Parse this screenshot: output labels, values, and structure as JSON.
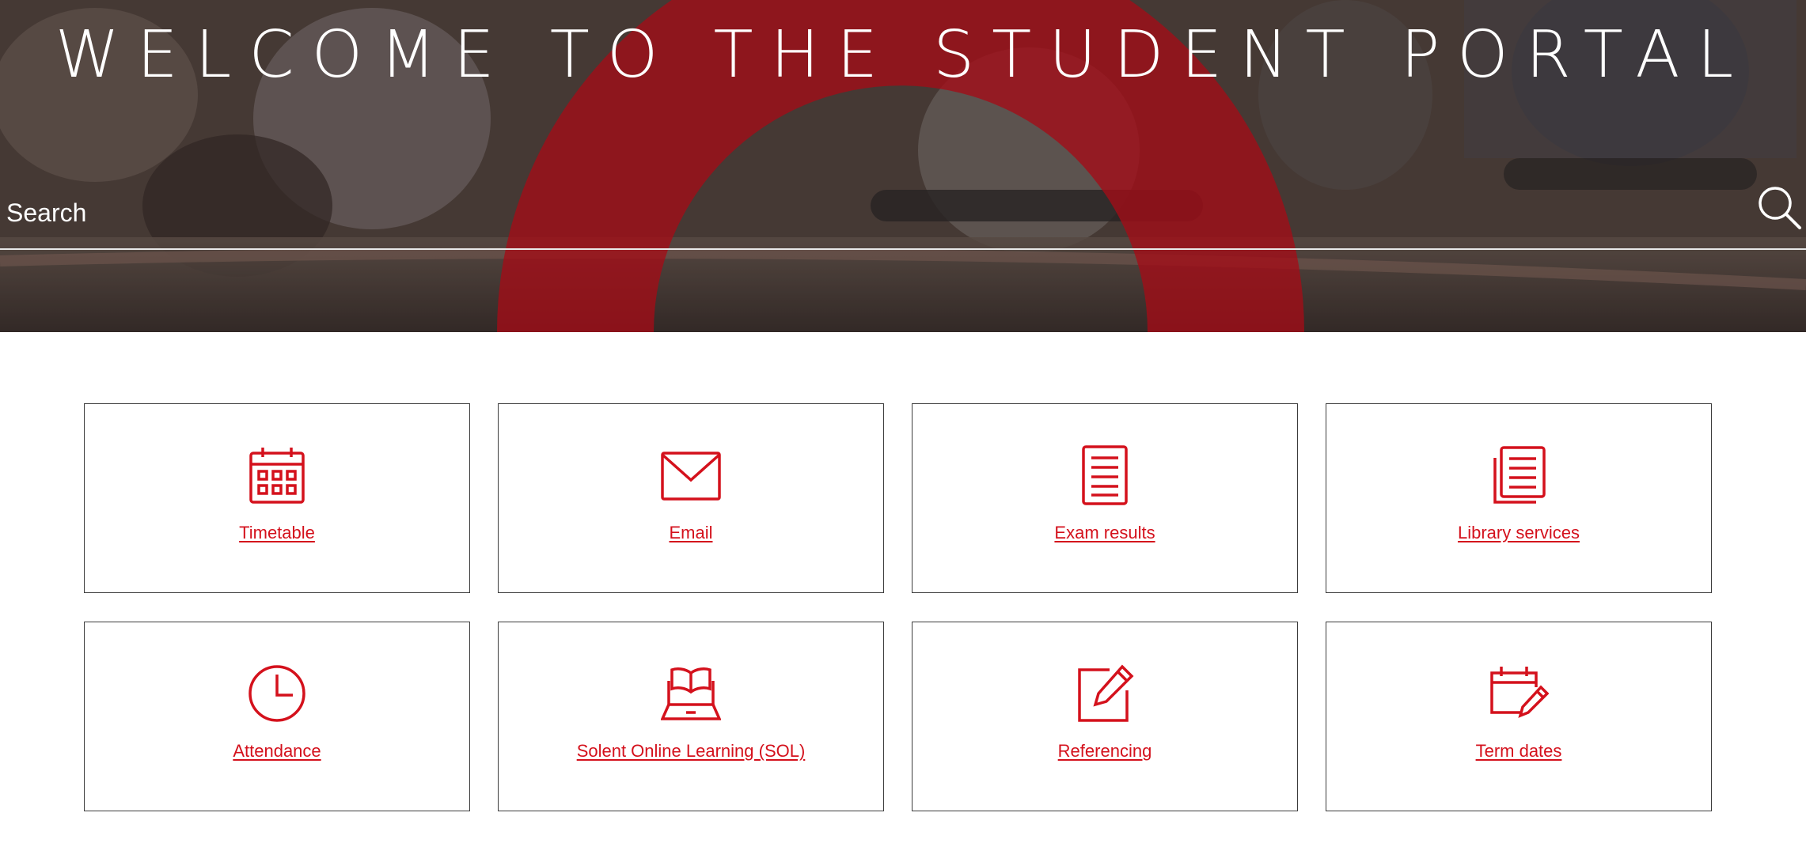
{
  "hero": {
    "title": "WELCOME TO THE STUDENT PORTAL",
    "search_placeholder": "Search",
    "search_icon": "search-icon"
  },
  "colors": {
    "accent": "#d4111c",
    "tile_border": "#3c3c3c",
    "hero_overlay_red": "#c8101c"
  },
  "tiles": [
    {
      "label": "Timetable",
      "icon": "calendar-icon"
    },
    {
      "label": "Email",
      "icon": "envelope-icon"
    },
    {
      "label": "Exam results",
      "icon": "document-icon"
    },
    {
      "label": "Library services",
      "icon": "documents-stack-icon"
    },
    {
      "label": "Attendance",
      "icon": "clock-icon"
    },
    {
      "label": "Solent Online Learning (SOL)",
      "icon": "laptop-book-icon"
    },
    {
      "label": "Referencing",
      "icon": "edit-pencil-icon"
    },
    {
      "label": "Term dates",
      "icon": "calendar-edit-icon"
    }
  ]
}
